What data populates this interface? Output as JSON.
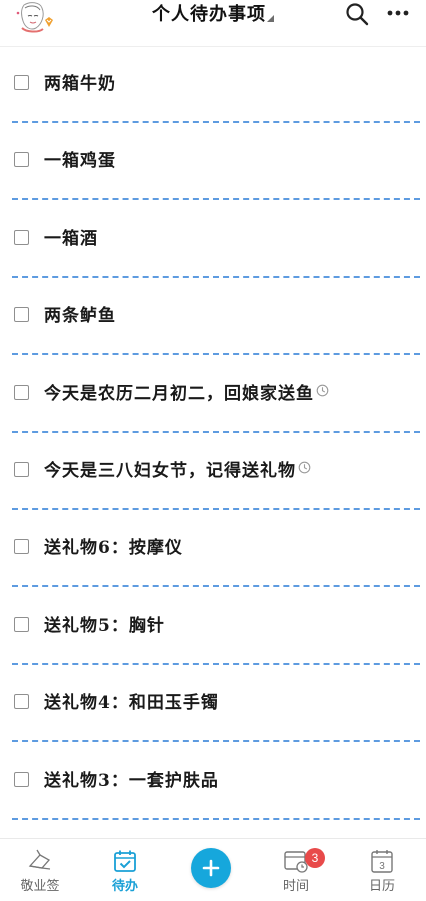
{
  "header": {
    "title": "个人待办事项",
    "icons": [
      "avatar",
      "title-dropdown-caret-icon",
      "search-icon",
      "more-icon"
    ]
  },
  "todos": [
    {
      "text": "两箱牛奶",
      "checked": false,
      "has_reminder": false
    },
    {
      "text": "一箱鸡蛋",
      "checked": false,
      "has_reminder": false
    },
    {
      "text": "一箱酒",
      "checked": false,
      "has_reminder": false
    },
    {
      "text": "两条鲈鱼",
      "checked": false,
      "has_reminder": false
    },
    {
      "text": "今天是农历二月初二，回娘家送鱼",
      "checked": false,
      "has_reminder": true
    },
    {
      "text": "今天是三八妇女节，记得送礼物",
      "checked": false,
      "has_reminder": true
    },
    {
      "text": "送礼物6：按摩仪",
      "checked": false,
      "has_reminder": false
    },
    {
      "text": "送礼物5：胸针",
      "checked": false,
      "has_reminder": false
    },
    {
      "text": "送礼物4：和田玉手镯",
      "checked": false,
      "has_reminder": false
    },
    {
      "text": "送礼物3：一套护肤品",
      "checked": false,
      "has_reminder": false
    }
  ],
  "bottom_nav": {
    "items": [
      {
        "label": "敬业签",
        "icon": "logo-icon",
        "active": false
      },
      {
        "label": "待办",
        "icon": "todo-calendar-check-icon",
        "active": true
      },
      {
        "label": "",
        "icon": "add-plus-icon",
        "active": false
      },
      {
        "label": "时间",
        "icon": "time-calendar-clock-icon",
        "active": false,
        "badge": "3"
      },
      {
        "label": "日历",
        "icon": "calendar-icon",
        "active": false,
        "calendar_day": "3"
      }
    ]
  },
  "colors": {
    "accent": "#16a7dc",
    "divider": "#5d9be0",
    "badge": "#e84a4a",
    "text": "#1a1a1a"
  }
}
